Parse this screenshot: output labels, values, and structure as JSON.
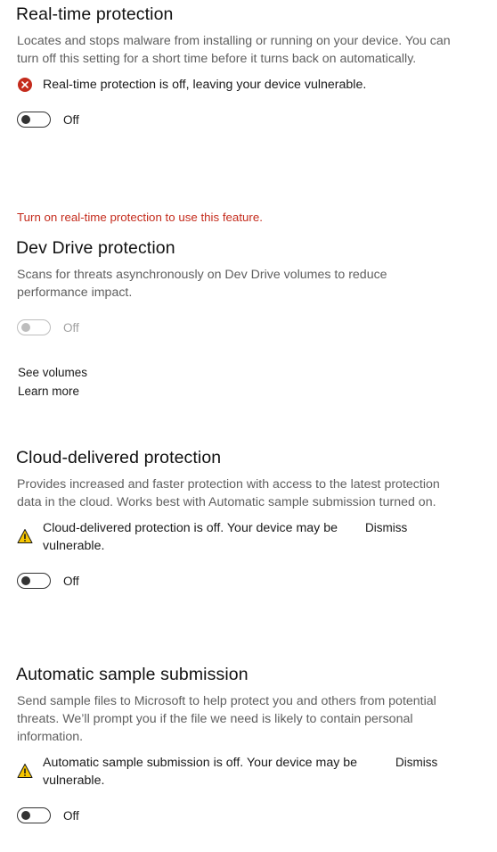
{
  "realtime": {
    "title": "Real-time protection",
    "description": "Locates and stops malware from installing or running on your device. You can turn off this setting for a short time before it turns back on automatically.",
    "status_text": "Real-time protection is off, leaving your device vulnerable.",
    "status_icon": "error-icon",
    "toggle_label": "Off",
    "toggle_on": false
  },
  "devdrive": {
    "requirement_note": "Turn on real-time protection to use this feature.",
    "title": "Dev Drive protection",
    "description": "Scans for threats asynchronously on Dev Drive volumes to reduce performance impact.",
    "toggle_label": "Off",
    "toggle_on": false,
    "toggle_disabled": true,
    "see_volumes": "See volumes",
    "learn_more": "Learn more"
  },
  "cloud": {
    "title": "Cloud-delivered protection",
    "description": "Provides increased and faster protection with access to the latest protection data in the cloud. Works best with Automatic sample submission turned on.",
    "status_text": "Cloud-delivered protection is off. Your device may be vulnerable.",
    "status_icon": "warning-icon",
    "dismiss_label": "Dismiss",
    "toggle_label": "Off",
    "toggle_on": false
  },
  "sample": {
    "title": "Automatic sample submission",
    "description": "Send sample files to Microsoft to help protect you and others from potential threats. We’ll prompt you if the file we need is likely to contain personal information.",
    "status_text": "Automatic sample submission is off. Your device may be vulnerable.",
    "status_icon": "warning-icon",
    "dismiss_label": "Dismiss",
    "toggle_label": "Off",
    "toggle_on": false
  },
  "colors": {
    "error_red": "#c42b1c",
    "warning_yellow": "#f7c600",
    "description_gray": "#5f5f5f"
  }
}
